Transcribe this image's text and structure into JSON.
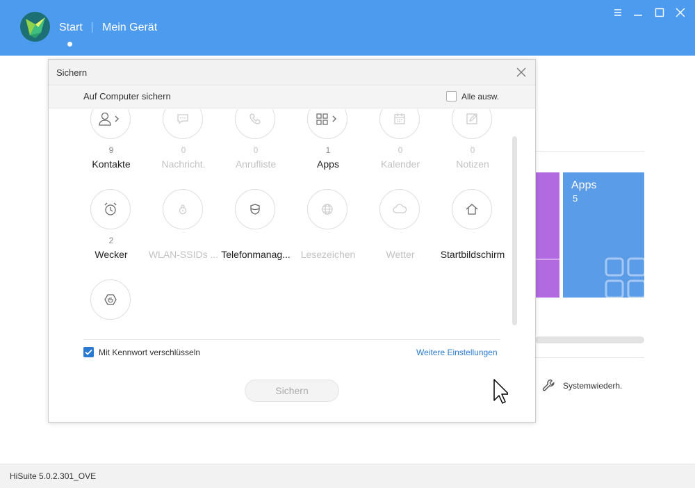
{
  "topbar": {
    "nav": {
      "start": "Start",
      "device": "Mein Gerät"
    },
    "colors": {
      "bar": "#4d9bee"
    },
    "window_controls": [
      "menu-icon",
      "minimize-icon",
      "maximize-icon",
      "close-icon"
    ]
  },
  "background": {
    "apps_tile": {
      "label": "Apps",
      "count": "5",
      "color": "#5b9ce8"
    },
    "purple_tile_color": "#b26ae0",
    "system_restore": "Systemwiederh."
  },
  "dialog": {
    "title": "Sichern",
    "subtitle": "Auf Computer sichern",
    "select_all": "Alle ausw.",
    "items": [
      {
        "icon": "contacts-icon",
        "count": "9",
        "label": "Kontakte",
        "enabled": true,
        "arrow": true
      },
      {
        "icon": "messages-icon",
        "count": "0",
        "label": "Nachricht.",
        "enabled": false,
        "arrow": false
      },
      {
        "icon": "phone-icon",
        "count": "0",
        "label": "Anrufliste",
        "enabled": false,
        "arrow": false
      },
      {
        "icon": "apps-icon",
        "count": "1",
        "label": "Apps",
        "enabled": true,
        "arrow": true
      },
      {
        "icon": "calendar-icon",
        "count": "0",
        "label": "Kalender",
        "enabled": false,
        "arrow": false
      },
      {
        "icon": "notes-icon",
        "count": "0",
        "label": "Notizen",
        "enabled": false,
        "arrow": false
      },
      {
        "icon": "alarm-icon",
        "count": "2",
        "label": "Wecker",
        "enabled": true,
        "arrow": false
      },
      {
        "icon": "wlan-lock-icon",
        "count": "",
        "label": "WLAN-SSIDs ...",
        "enabled": false,
        "arrow": false
      },
      {
        "icon": "shield-icon",
        "count": "",
        "label": "Telefonmanag...",
        "enabled": true,
        "arrow": false
      },
      {
        "icon": "globe-icon",
        "count": "",
        "label": "Lesezeichen",
        "enabled": false,
        "arrow": false
      },
      {
        "icon": "cloud-icon",
        "count": "",
        "label": "Wetter",
        "enabled": false,
        "arrow": false
      },
      {
        "icon": "home-icon",
        "count": "",
        "label": "Startbildschirm",
        "enabled": true,
        "arrow": false
      },
      {
        "icon": "hexagon-icon",
        "count": "",
        "label": "",
        "enabled": true,
        "arrow": false
      }
    ],
    "encrypt_label": "Mit Kennwort verschlüsseln",
    "encrypt_checked": true,
    "more_settings": "Weitere Einstellungen",
    "save_button": "Sichern",
    "accent": "#2a7ad1"
  },
  "statusbar": {
    "version": "HiSuite 5.0.2.301_OVE"
  }
}
